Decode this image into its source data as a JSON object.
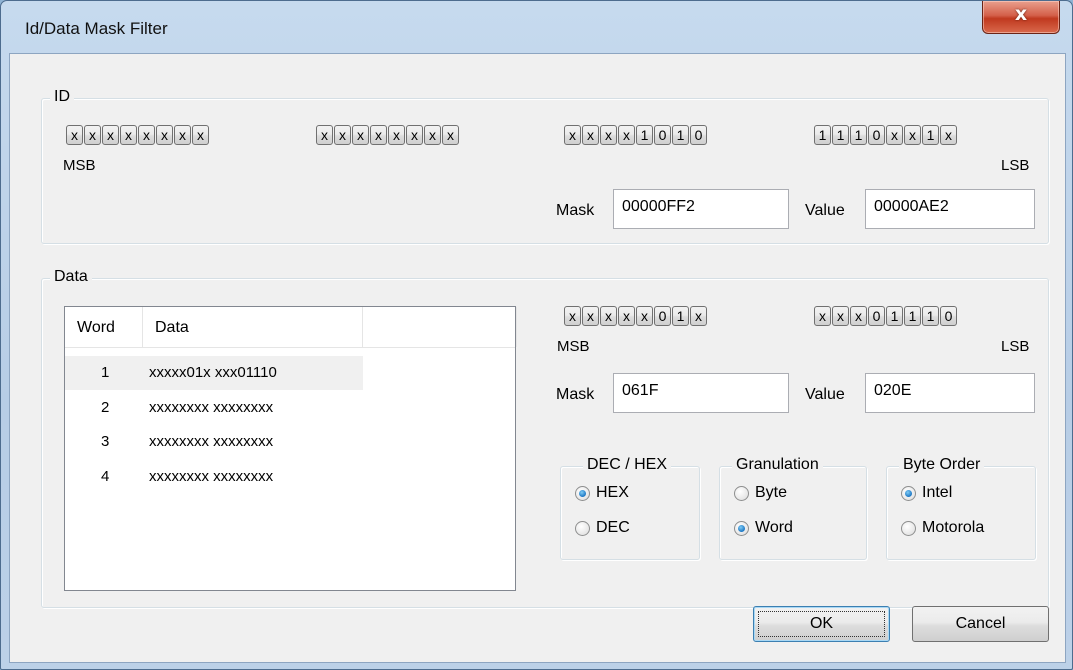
{
  "window": {
    "title": "Id/Data Mask Filter",
    "close_glyph": "x"
  },
  "id_group": {
    "label": "ID",
    "bytes": [
      [
        "x",
        "x",
        "x",
        "x",
        "x",
        "x",
        "x",
        "x"
      ],
      [
        "x",
        "x",
        "x",
        "x",
        "x",
        "x",
        "x",
        "x"
      ],
      [
        "x",
        "x",
        "x",
        "x",
        "1",
        "0",
        "1",
        "0"
      ],
      [
        "1",
        "1",
        "1",
        "0",
        "x",
        "x",
        "1",
        "x"
      ]
    ],
    "msb_label": "MSB",
    "lsb_label": "LSB",
    "mask_label": "Mask",
    "mask_value": "00000FF2",
    "value_label": "Value",
    "value_value": "00000AE2"
  },
  "data_group": {
    "label": "Data",
    "list": {
      "columns": [
        "Word",
        "Data"
      ],
      "rows": [
        {
          "word": "1",
          "data": "xxxxx01x xxx01110"
        },
        {
          "word": "2",
          "data": "xxxxxxxx xxxxxxxx"
        },
        {
          "word": "3",
          "data": "xxxxxxxx xxxxxxxx"
        },
        {
          "word": "4",
          "data": "xxxxxxxx xxxxxxxx"
        }
      ],
      "selected_row": 0
    },
    "bytes": [
      [
        "x",
        "x",
        "x",
        "x",
        "x",
        "0",
        "1",
        "x"
      ],
      [
        "x",
        "x",
        "x",
        "0",
        "1",
        "1",
        "1",
        "0"
      ]
    ],
    "msb_label": "MSB",
    "lsb_label": "LSB",
    "mask_label": "Mask",
    "mask_value": "061F",
    "value_label": "Value",
    "value_value": "020E",
    "dechex": {
      "label": "DEC / HEX",
      "options": [
        "HEX",
        "DEC"
      ],
      "selected": "HEX"
    },
    "granulation": {
      "label": "Granulation",
      "options": [
        "Byte",
        "Word"
      ],
      "selected": "Word"
    },
    "byte_order": {
      "label": "Byte Order",
      "options": [
        "Intel",
        "Motorola"
      ],
      "selected": "Intel"
    }
  },
  "buttons": {
    "ok": "OK",
    "cancel": "Cancel"
  },
  "colors": {
    "title_bg": "#c6daee",
    "client_bg": "#f0f0f0",
    "close_red": "#c0391f",
    "radio_checked": "#1d77c4"
  }
}
